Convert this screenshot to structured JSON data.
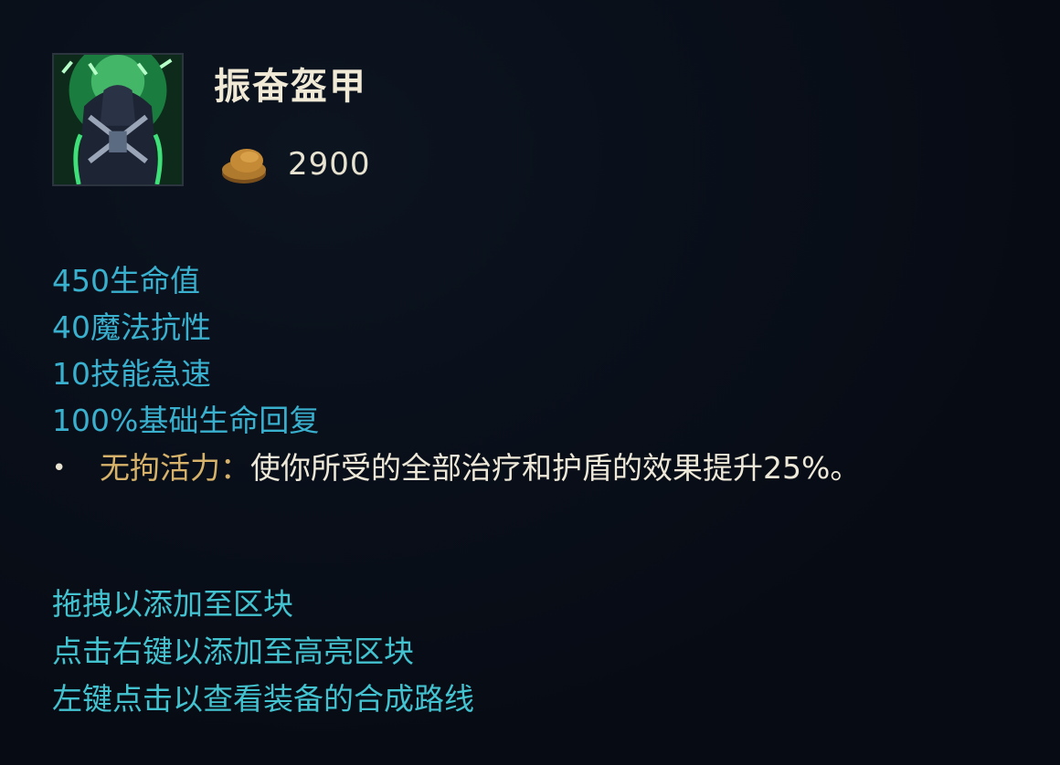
{
  "item": {
    "name": "振奋盔甲",
    "cost": "2900",
    "icon": "armor-item-icon",
    "gold_icon": "gold-coin-icon"
  },
  "stats": [
    "450生命值",
    "40魔法抗性",
    "10技能急速",
    "100%基础生命回复"
  ],
  "passive": {
    "bullet": "•",
    "name": "无拘活力：",
    "description": "使你所受的全部治疗和护盾的效果提升25%。"
  },
  "hints": [
    "拖拽以添加至区块",
    "点击右键以添加至高亮区块",
    "左键点击以查看装备的合成路线"
  ],
  "colors": {
    "background": "#080d17",
    "title": "#efe9d6",
    "stat": "#3ab0cf",
    "passive_name": "#d6b26a",
    "hint": "#43c2cf",
    "gold": "#b07a2e"
  }
}
